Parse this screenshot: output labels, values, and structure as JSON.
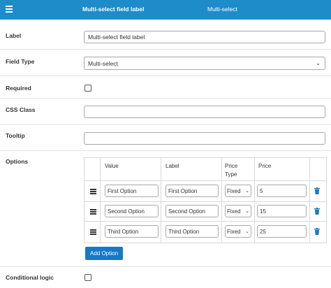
{
  "header": {
    "title": "Multi-select field label",
    "type": "Multi-select"
  },
  "fields": {
    "label": {
      "label": "Label",
      "value": "Multi-select field label"
    },
    "field_type": {
      "label": "Field Type",
      "value": "Multi-select"
    },
    "required": {
      "label": "Required",
      "checked": false
    },
    "css_class": {
      "label": "CSS Class",
      "value": ""
    },
    "tooltip": {
      "label": "Tooltip",
      "value": ""
    },
    "options": {
      "label": "Options",
      "columns": {
        "value": "Value",
        "label": "Label",
        "price_type_1": "Price",
        "price_type_2": "Type",
        "price": "Price"
      },
      "rows": [
        {
          "value": "First Option",
          "label": "First Option",
          "price_type": "Fixed",
          "price": "5"
        },
        {
          "value": "Second Option",
          "label": "Second Option",
          "price_type": "Fixed",
          "price": "15"
        },
        {
          "value": "Third Option",
          "label": "Third Option",
          "price_type": "Fixed",
          "price": "25"
        }
      ],
      "add_button": "Add Option"
    },
    "conditional_logic": {
      "label": "Conditional logic",
      "checked": false
    }
  },
  "colors": {
    "accent": "#1e8cc8",
    "button": "#1479c6",
    "delete": "#1479c6"
  }
}
